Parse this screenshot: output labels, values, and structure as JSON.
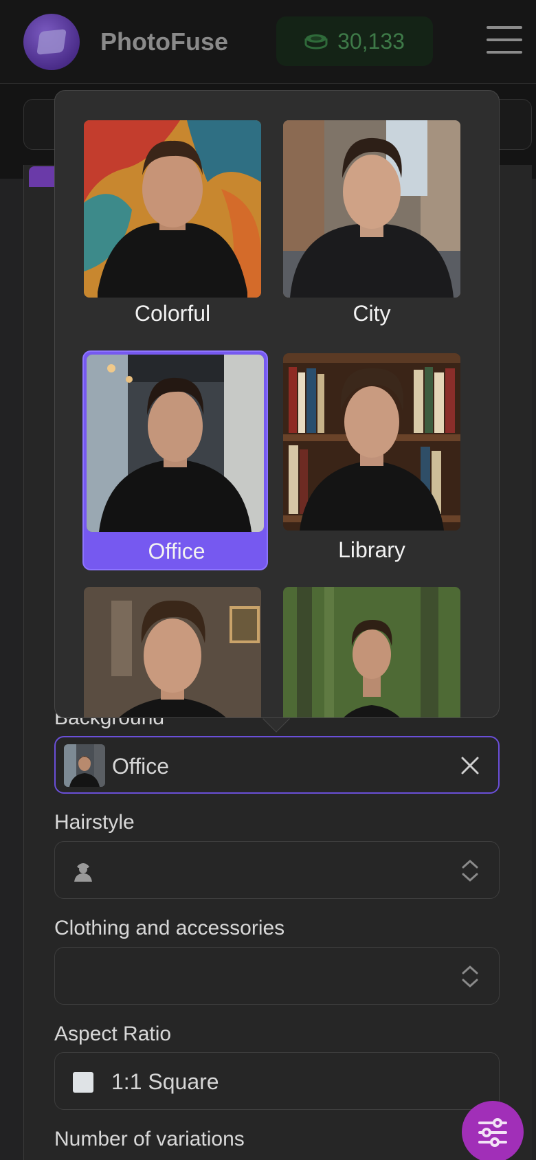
{
  "header": {
    "brand": "PhotoFuse",
    "credits": "30,133",
    "icons": {
      "logo": "photofuse-logo",
      "coin": "coin-stack-icon",
      "menu": "hamburger-menu-icon"
    }
  },
  "background_picker": {
    "options": [
      {
        "label": "Colorful",
        "selected": false
      },
      {
        "label": "City",
        "selected": false
      },
      {
        "label": "Office",
        "selected": true
      },
      {
        "label": "Library",
        "selected": false
      },
      {
        "label": "",
        "selected": false
      },
      {
        "label": "",
        "selected": false
      }
    ]
  },
  "form": {
    "background": {
      "label": "Background",
      "value": "Office"
    },
    "hairstyle": {
      "label": "Hairstyle",
      "value": ""
    },
    "clothing": {
      "label": "Clothing and accessories",
      "value": ""
    },
    "aspect": {
      "label": "Aspect Ratio",
      "value": "1:1 Square"
    },
    "variations": {
      "label": "Number of variations"
    }
  },
  "colors": {
    "accent": "#7659f0",
    "fab": "#a12fb8",
    "credits_text": "#3e7a48"
  }
}
